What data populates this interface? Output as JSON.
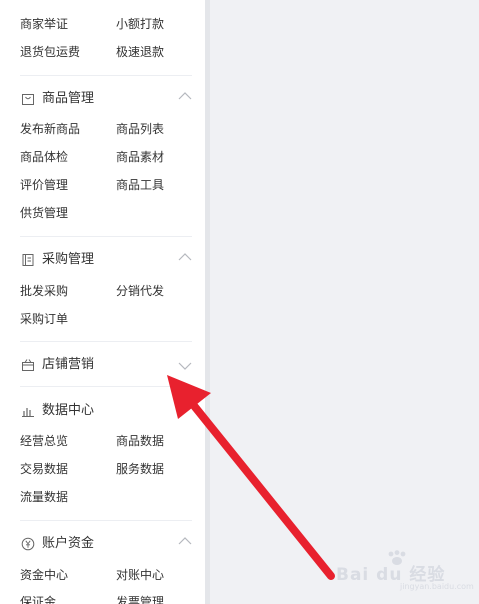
{
  "sections": [
    {
      "id": "top",
      "items": [
        "商家举证",
        "小额打款",
        "退货包运费",
        "极速退款"
      ]
    },
    {
      "id": "goods",
      "title": "商品管理",
      "icon": "bag-icon",
      "expanded": true,
      "items": [
        "发布新商品",
        "商品列表",
        "商品体检",
        "商品素材",
        "评价管理",
        "商品工具",
        "供货管理"
      ]
    },
    {
      "id": "purchase",
      "title": "采购管理",
      "icon": "document-icon",
      "expanded": true,
      "items": [
        "批发采购",
        "分销代发",
        "采购订单"
      ]
    },
    {
      "id": "marketing",
      "title": "店铺营销",
      "icon": "gift-icon",
      "expanded": false,
      "items": []
    },
    {
      "id": "data",
      "title": "数据中心",
      "icon": "bar-chart-icon",
      "expanded": true,
      "items": [
        "经营总览",
        "商品数据",
        "交易数据",
        "服务数据",
        "流量数据"
      ]
    },
    {
      "id": "account",
      "title": "账户资金",
      "icon": "yuan-icon",
      "expanded": true,
      "items": [
        "资金中心",
        "对账中心",
        "保证金",
        "发票管理"
      ]
    }
  ],
  "watermark": {
    "text": "Bai du 经验",
    "sub": "jingyan.baidu.com"
  },
  "colors": {
    "annotation_arrow": "#e8212e",
    "sidebar_bg": "#ffffff",
    "content_bg": "#f0f1f4"
  }
}
